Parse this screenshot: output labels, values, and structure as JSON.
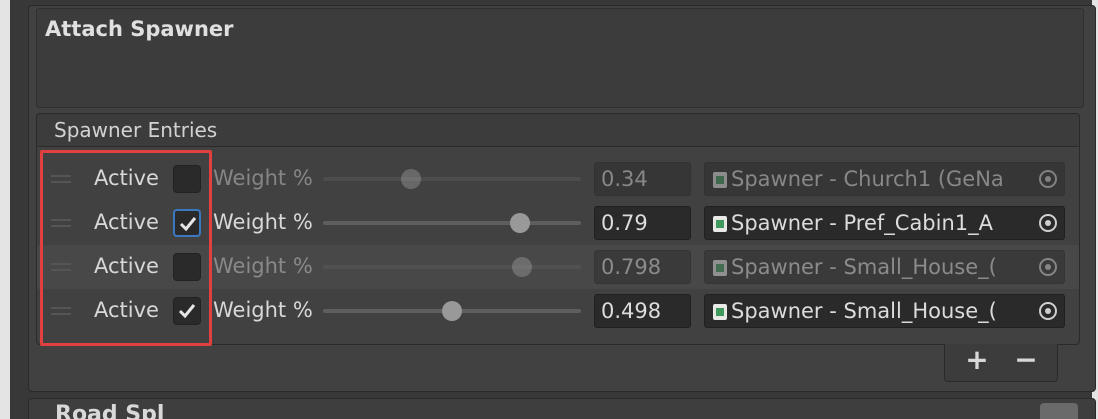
{
  "panel": {
    "title": "Attach Spawner",
    "list_title": "Spawner Entries"
  },
  "rows": [
    {
      "active_label": "Active",
      "checked": false,
      "weight_label": "Weight %",
      "weight": "0.34",
      "object": "Spawner - Church1 (GeNa",
      "enabled": false
    },
    {
      "active_label": "Active",
      "checked": true,
      "weight_label": "Weight %",
      "weight": "0.79",
      "object": "Spawner - Pref_Cabin1_A",
      "enabled": true
    },
    {
      "active_label": "Active",
      "checked": false,
      "weight_label": "Weight %",
      "weight": "0.798",
      "object": "Spawner - Small_House_(",
      "enabled": false
    },
    {
      "active_label": "Active",
      "checked": true,
      "weight_label": "Weight %",
      "weight": "0.498",
      "object": "Spawner - Small_House_(",
      "enabled": true
    }
  ],
  "footer": {
    "add_label": "+",
    "remove_label": "−"
  },
  "next_section": {
    "title": "Road Spl"
  },
  "colors": {
    "highlight": "#e04040",
    "focus": "#3a79bf",
    "script_icon": "#3e9a5a"
  },
  "icons": [
    "drag-handle-icon",
    "checkmark-icon",
    "script-file-icon",
    "object-picker-icon"
  ]
}
